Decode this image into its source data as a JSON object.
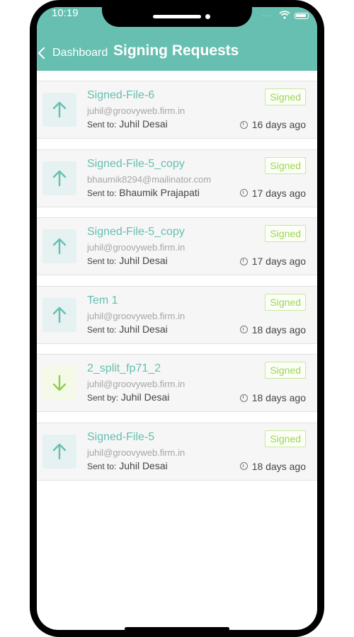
{
  "status_bar": {
    "time": "10:19",
    "signal": "....",
    "wifi_icon": "wifi-icon",
    "battery_icon": "battery-icon"
  },
  "nav": {
    "back_label": "Dashboard",
    "title": "Signing Requests"
  },
  "colors": {
    "header": "#66bfb0",
    "accent": "#66bfb0",
    "badge": "#9fd45c"
  },
  "requests": [
    {
      "name": "Signed-File-6",
      "email": "juhil@groovyweb.firm.in",
      "direction": "up",
      "sent_prefix": "Sent to:",
      "person": "Juhil Desai",
      "ago": "16 days ago",
      "status": "Signed"
    },
    {
      "name": "Signed-File-5_copy",
      "email": "bhaumik8294@mailinator.com",
      "direction": "up",
      "sent_prefix": "Sent to:",
      "person": "Bhaumik Prajapati",
      "ago": "17 days ago",
      "status": "Signed"
    },
    {
      "name": "Signed-File-5_copy",
      "email": "juhil@groovyweb.firm.in",
      "direction": "up",
      "sent_prefix": "Sent to:",
      "person": "Juhil Desai",
      "ago": "17 days ago",
      "status": "Signed"
    },
    {
      "name": "Tem 1",
      "email": "juhil@groovyweb.firm.in",
      "direction": "up",
      "sent_prefix": "Sent to:",
      "person": "Juhil Desai",
      "ago": "18 days ago",
      "status": "Signed"
    },
    {
      "name": "2_split_fp71_2",
      "email": "juhil@groovyweb.firm.in",
      "direction": "down",
      "sent_prefix": "Sent by:",
      "person": "Juhil Desai",
      "ago": "18 days ago",
      "status": "Signed"
    },
    {
      "name": "Signed-File-5",
      "email": "juhil@groovyweb.firm.in",
      "direction": "up",
      "sent_prefix": "Sent to:",
      "person": "Juhil Desai",
      "ago": "18 days ago",
      "status": "Signed"
    }
  ]
}
